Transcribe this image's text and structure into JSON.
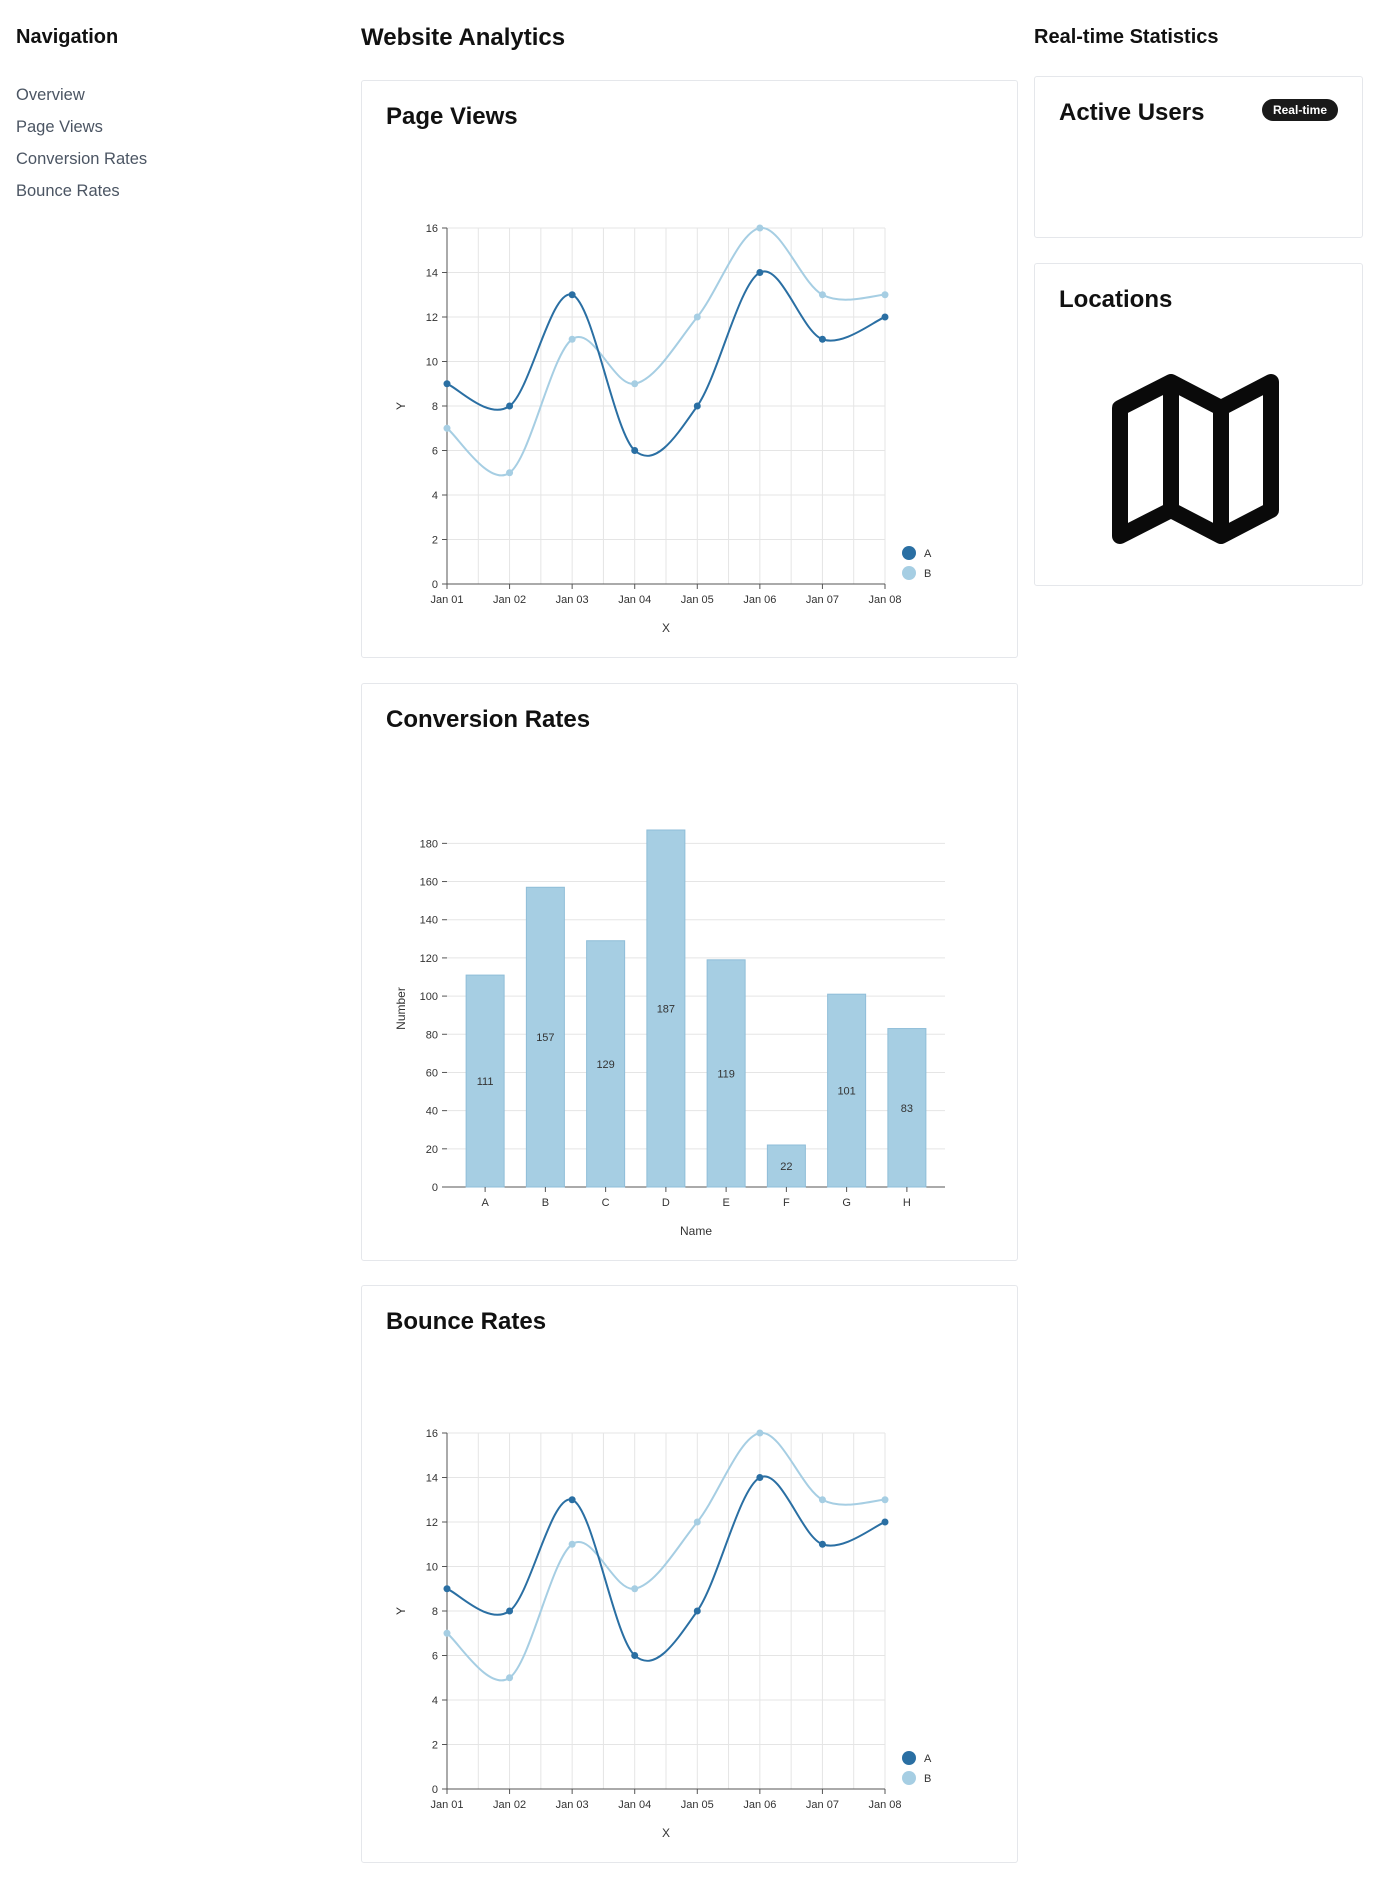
{
  "nav": {
    "title": "Navigation",
    "items": [
      {
        "label": "Overview"
      },
      {
        "label": "Page Views"
      },
      {
        "label": "Conversion Rates"
      },
      {
        "label": "Bounce Rates"
      }
    ]
  },
  "main": {
    "title": "Website Analytics"
  },
  "sidebar": {
    "title": "Real-time Statistics",
    "active_users": {
      "title": "Active Users",
      "badge": "Real-time"
    },
    "locations": {
      "title": "Locations",
      "icon": "map-icon"
    }
  },
  "colors": {
    "series_a": "#2a6fa3",
    "series_b": "#a6cee3",
    "bar": "#a6cee3",
    "grid": "#e5e5e5"
  },
  "chart_data": [
    {
      "id": "page_views",
      "card_title": "Page Views",
      "type": "line",
      "x": [
        "Jan 01",
        "Jan 02",
        "Jan 03",
        "Jan 04",
        "Jan 05",
        "Jan 06",
        "Jan 07",
        "Jan 08"
      ],
      "series": [
        {
          "name": "A",
          "values": [
            9,
            8,
            13,
            6,
            8,
            14,
            11,
            12
          ]
        },
        {
          "name": "B",
          "values": [
            7,
            5,
            11,
            9,
            12,
            16,
            13,
            13
          ]
        }
      ],
      "xlabel": "X",
      "ylabel": "Y",
      "ylim": [
        0,
        16
      ],
      "yticks": [
        0,
        2,
        4,
        6,
        8,
        10,
        12,
        14,
        16
      ],
      "grid": true,
      "legend": "bottom-right"
    },
    {
      "id": "conversion_rates",
      "card_title": "Conversion Rates",
      "type": "bar",
      "categories": [
        "A",
        "B",
        "C",
        "D",
        "E",
        "F",
        "G",
        "H"
      ],
      "values": [
        111,
        157,
        129,
        187,
        119,
        22,
        101,
        83
      ],
      "xlabel": "Name",
      "ylabel": "Number",
      "ylim": [
        0,
        187
      ],
      "yticks": [
        0,
        20,
        40,
        60,
        80,
        100,
        120,
        140,
        160,
        180
      ],
      "grid": true
    },
    {
      "id": "bounce_rates",
      "card_title": "Bounce Rates",
      "type": "line",
      "x": [
        "Jan 01",
        "Jan 02",
        "Jan 03",
        "Jan 04",
        "Jan 05",
        "Jan 06",
        "Jan 07",
        "Jan 08"
      ],
      "series": [
        {
          "name": "A",
          "values": [
            9,
            8,
            13,
            6,
            8,
            14,
            11,
            12
          ]
        },
        {
          "name": "B",
          "values": [
            7,
            5,
            11,
            9,
            12,
            16,
            13,
            13
          ]
        }
      ],
      "xlabel": "X",
      "ylabel": "Y",
      "ylim": [
        0,
        16
      ],
      "yticks": [
        0,
        2,
        4,
        6,
        8,
        10,
        12,
        14,
        16
      ],
      "grid": true,
      "legend": "bottom-right"
    }
  ]
}
